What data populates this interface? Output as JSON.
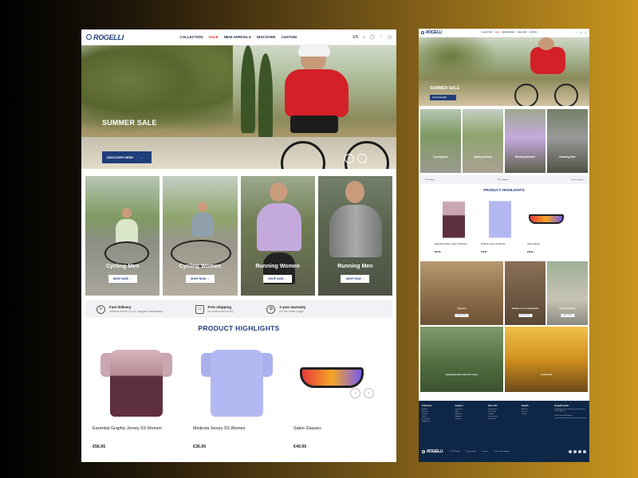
{
  "brand": "ROGELLI",
  "nav": {
    "items": [
      "COLLECTION",
      "SALE",
      "NEW ARRIVALS",
      "DISCOVER",
      "CUSTOM"
    ],
    "language": "EN"
  },
  "hero": {
    "title": "SUMMER SALE",
    "button": "DISCOVER HERE"
  },
  "categories": [
    {
      "label": "Cycling Men",
      "button": "SHOP NOW"
    },
    {
      "label": "Cycling Women",
      "button": "SHOP NOW"
    },
    {
      "label": "Running Women",
      "button": "SHOP NOW"
    },
    {
      "label": "Running Men",
      "button": "SHOP NOW"
    }
  ],
  "usps": [
    {
      "title": "Fast delivery",
      "subtitle": "ordered before 3 p.m., shipped immediately"
    },
    {
      "title": "Free shipping",
      "subtitle": "for orders from €100,-"
    },
    {
      "title": "2 year warranty",
      "subtitle": "On the entire range"
    }
  ],
  "highlights": {
    "title": "PRODUCT HIGHLIGHTS",
    "products": [
      {
        "name": "Essential Graphic Jersey SS Women",
        "price": "€56.95"
      },
      {
        "name": "Modesta Jersey SS Women",
        "price": "€36.95"
      },
      {
        "name": "Sabre Glasses",
        "price": "€49.95"
      }
    ]
  },
  "side": {
    "hero_title": "SUMMER SALE",
    "hero_button": "DISCOVER HERE",
    "grid": [
      {
        "label": "Explore",
        "button": "SHOP NOW"
      },
      {
        "label": "Follow us on Instagram",
        "button": "SHOP NOW"
      },
      {
        "label": "Our favourites",
        "button": "SHOP NOW"
      }
    ],
    "wide": [
      {
        "label": "#enjoytheride read our story"
      },
      {
        "label": "Lookbook"
      }
    ],
    "footer": {
      "columns": [
        {
          "heading": "Collection",
          "items": [
            "Cycling",
            "Running",
            "Clothing",
            "Outlet",
            "Accessories",
            "Highlighted"
          ]
        },
        {
          "heading": "Support",
          "items": [
            "Contact us",
            "FAQ",
            "Warranty",
            "Shipping",
            "Returns"
          ]
        },
        {
          "heading": "More info",
          "items": [
            "Professional",
            "Size Guide",
            "Cookies",
            "Terms of sale",
            "Vacancies"
          ]
        },
        {
          "heading": "Rogelli",
          "items": [
            "About us",
            "Partners",
            "Careers"
          ]
        },
        {
          "heading": "Rogelli Insider",
          "items": [
            "Subscribe to our newsletter and receive the latest updates"
          ]
        }
      ],
      "newsletter_placeholder": "Enter your email address",
      "bottom_links": [
        "© 2024 Rogelli",
        "Privacy policy",
        "Cookies",
        "Terms and conditions"
      ]
    }
  }
}
